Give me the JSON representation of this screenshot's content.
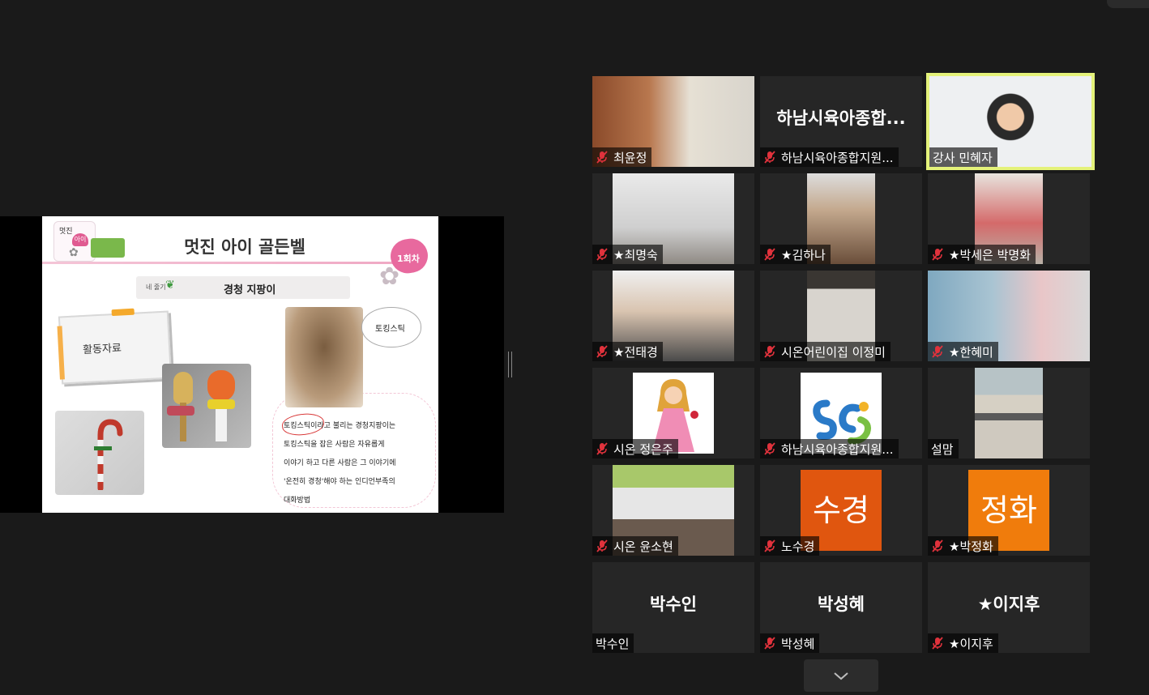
{
  "slide": {
    "logo_text": "멋진",
    "logo_heart_text": "아이",
    "title": "멋진 아이 골든벨",
    "session_badge": "1회차",
    "sub_small": "네 줄기",
    "subtitle": "경청 지팡이",
    "activity_label": "활동자료",
    "bubble_text": "토킹스틱",
    "description_lines": [
      "토킹스틱이라고 불리는 경청지팡이는",
      "토킹스틱을 잡은 사람은 자유롭게",
      "이야기 하고 다른 사람은 그 이야기에",
      "'온전히 경청'해야 하는 인디언부족의",
      "대화방법"
    ]
  },
  "participants": [
    {
      "name": "최윤정",
      "muted": true,
      "video": "room"
    },
    {
      "name": "하남시육아종합지원...",
      "muted": true,
      "display": "하남시육아종합..."
    },
    {
      "name": "강사 민혜자",
      "muted": false,
      "video": "host",
      "active_speaker": true
    },
    {
      "name": "★최명숙",
      "muted": true,
      "video": "ceiling"
    },
    {
      "name": "★김하나",
      "muted": true,
      "video": "kitchen"
    },
    {
      "name": "★박세은 박명화",
      "muted": true,
      "video": "child"
    },
    {
      "name": "★전태경",
      "muted": true,
      "video": "family"
    },
    {
      "name": "시온어린이집 이정미",
      "muted": true,
      "video": "wall"
    },
    {
      "name": "★한혜미",
      "muted": true,
      "video": "toddler"
    },
    {
      "name": "시온 정은주",
      "muted": true,
      "image": "princess"
    },
    {
      "name": "하남시육아종합지원...",
      "muted": true,
      "image": "logo"
    },
    {
      "name": "설맘",
      "muted": false,
      "video": "vent"
    },
    {
      "name": "시온 윤소현",
      "muted": true,
      "video": "classroom"
    },
    {
      "name": "노수경",
      "muted": true,
      "avatar": "수경"
    },
    {
      "name": "★박정화",
      "muted": true,
      "avatar": "정화"
    },
    {
      "name": "박수인",
      "muted": false,
      "display": "박수인"
    },
    {
      "name": "박성혜",
      "muted": true,
      "display": "박성혜"
    },
    {
      "name": "★이지후",
      "muted": true,
      "display": "★이지후"
    }
  ],
  "icons": {
    "mic_muted": "mic-muted-icon",
    "scroll": "chevron-down-icon"
  },
  "colors": {
    "active_speaker": "#e4f27a",
    "muted_icon": "#e0323c",
    "avatar": "#e0560f"
  }
}
